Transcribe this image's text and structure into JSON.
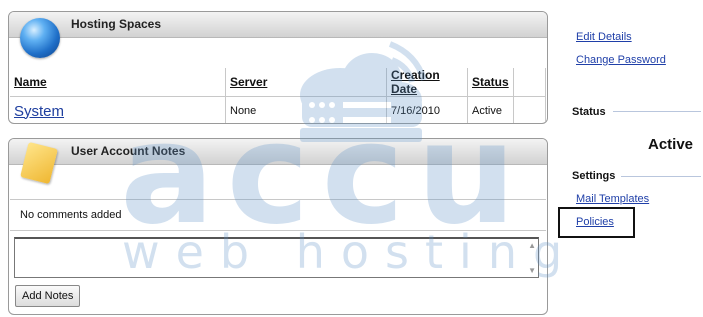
{
  "hosting_panel": {
    "title": "Hosting Spaces",
    "columns": [
      "Name",
      "Server",
      "Creation Date",
      "Status"
    ],
    "rows": [
      {
        "name": "System",
        "server": "None",
        "creation_date": "7/16/2010",
        "status": "Active"
      }
    ]
  },
  "notes_panel": {
    "title": "User Account Notes",
    "empty_message": "No comments added",
    "notes_input_value": "",
    "add_button_label": "Add Notes"
  },
  "sidebar": {
    "links": [
      "Edit Details",
      "Change Password"
    ],
    "status_header": "Status",
    "status_value": "Active",
    "settings_header": "Settings",
    "settings_links": [
      "Mail Templates",
      "Policies"
    ]
  },
  "watermark": {
    "brand": "accu",
    "tagline": "web hosting"
  }
}
